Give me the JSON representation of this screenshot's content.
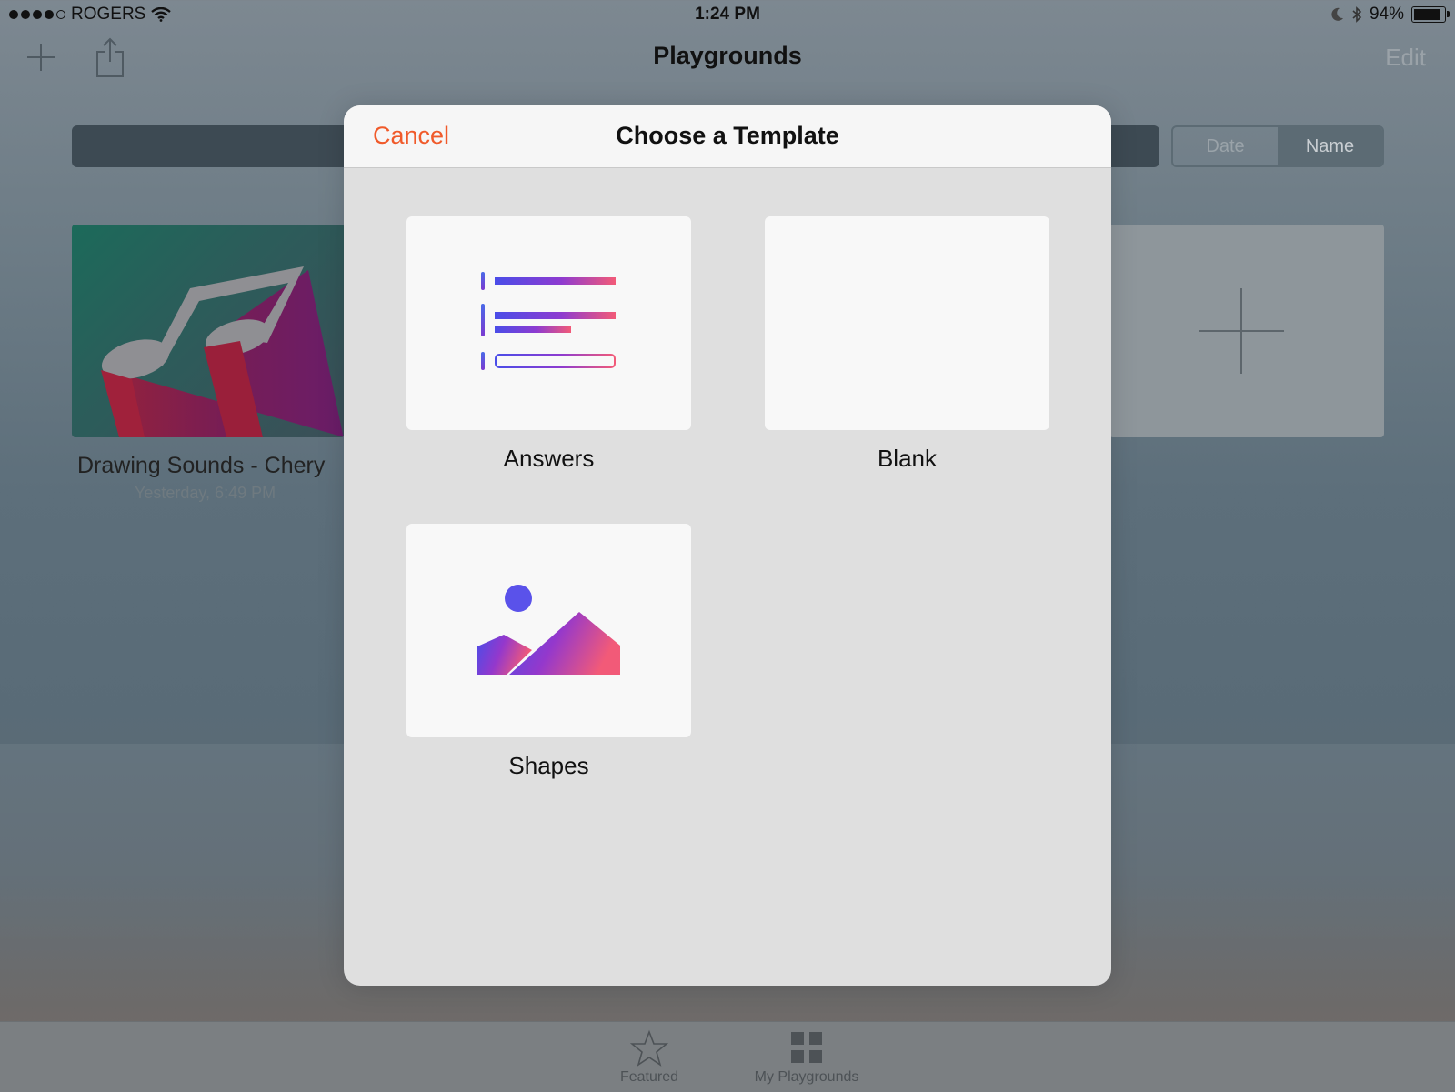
{
  "status_bar": {
    "carrier": "ROGERS",
    "time": "1:24 PM",
    "battery": "94%",
    "battery_level": 0.94
  },
  "nav": {
    "title": "Playgrounds",
    "edit_label": "Edit"
  },
  "sort": {
    "options": [
      "Date",
      "Name"
    ],
    "selected": "Name"
  },
  "playgrounds": [
    {
      "title": "Drawing Sounds - Chery",
      "subtitle": "Yesterday, 6:49 PM"
    }
  ],
  "tabs": [
    {
      "label": "Featured",
      "icon": "star-icon"
    },
    {
      "label": "My Playgrounds",
      "icon": "grid-icon"
    }
  ],
  "modal": {
    "cancel_label": "Cancel",
    "title": "Choose a Template",
    "templates": [
      {
        "label": "Answers",
        "icon": "answers-template-icon"
      },
      {
        "label": "Blank",
        "icon": ""
      },
      {
        "label": "Shapes",
        "icon": "shapes-template-icon"
      }
    ]
  },
  "colors": {
    "accent": "#f05a2a",
    "gradient_start": "#4a4de8",
    "gradient_mid": "#8e3bd0",
    "gradient_end": "#f25a78"
  }
}
